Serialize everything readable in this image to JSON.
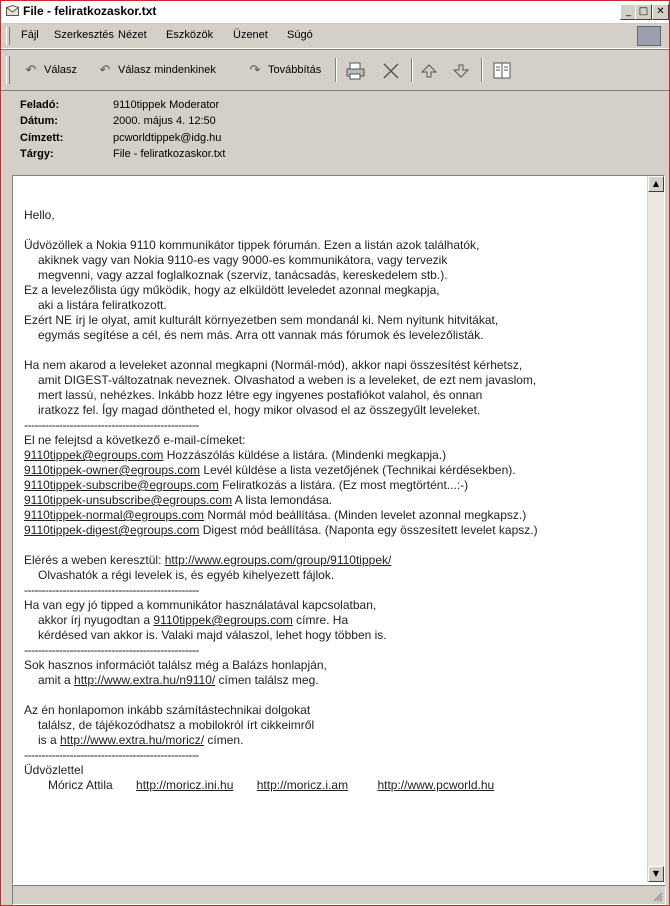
{
  "window": {
    "title": "File - feliratkozaskor.txt",
    "minimize_glyph": "_",
    "maximize_glyph": "□",
    "close_glyph": "✕"
  },
  "menu": [
    {
      "label": "Fájl"
    },
    {
      "label": "Szerkesztés"
    },
    {
      "label": "Nézet"
    },
    {
      "label": "Eszközök"
    },
    {
      "label": "Üzenet"
    },
    {
      "label": "Súgó"
    }
  ],
  "toolbar": {
    "reply": "Válasz",
    "reply_all": "Válasz mindenkinek",
    "forward": "Továbbítás"
  },
  "headers": [
    {
      "label": "Feladó:",
      "value": "9110tippek Moderator"
    },
    {
      "label": "Dátum:",
      "value": "2000. május 4. 12:50"
    },
    {
      "label": "Címzett:",
      "value": "pcworldtippek@idg.hu"
    },
    {
      "label": "Tárgy:",
      "value": "File - feliratkozaskor.txt"
    }
  ],
  "body": {
    "greeting": "Hello,",
    "intro": [
      "Üdvözöllek a Nokia 9110 kommunikátor tippek fórumán. Ezen a listán azok találhatók,",
      "akiknek vagy van Nokia 9110-es vagy 9000-es kommunikátora, vagy tervezik",
      "megvenni, vagy azzal foglalkoznak (szerviz, tanácsadás, kereskedelem stb.).",
      "Ez a levelezőlista úgy működik, hogy az elküldött leveledet azonnal megkapja,",
      "aki a listára feliratkozott.",
      "Ezért NE írj le olyat, amit kulturált környezetben sem mondanál ki. Nem nyitunk hitvitákat,",
      "egymás segítése a cél, és nem más. Arra ott vannak más fórumok és levelezőlisták."
    ],
    "digest": [
      "Ha nem akarod a leveleket azonnal megkapni (Normál-mód), akkor napi összesítést kérhetsz,",
      "amit DIGEST-változatnak neveznek. Olvashatod a weben is a leveleket, de ezt nem javaslom,",
      "mert lassú, nehézkes. Inkább hozz létre egy ingyenes postafiókot valahol, és onnan",
      "iratkozz fel. Így magad döntheted el, hogy mikor olvasod el az összegyűlt leveleket."
    ],
    "separator": "--------------------------------------------------",
    "addresses_intro": "El ne felejtsd a következő e-mail-címeket:",
    "addresses": [
      {
        "email": "9110tippek@egroups.com",
        "desc": " Hozzászólás küldése a listára. (Mindenki megkapja.)"
      },
      {
        "email": "9110tippek-owner@egroups.com",
        "desc": " Levél küldése a lista vezetőjének (Technikai kérdésekben)."
      },
      {
        "email": "9110tippek-subscribe@egroups.com",
        "desc": " Feliratkozás a listára. (Ez most megtörtént...:-)"
      },
      {
        "email": "9110tippek-unsubscribe@egroups.com",
        "desc": " A lista lemondása."
      },
      {
        "email": "9110tippek-normal@egroups.com",
        "desc": " Normál mód beállítása. (Minden levelet azonnal megkapsz.)"
      },
      {
        "email": "9110tippek-digest@egroups.com",
        "desc": " Digest mód beállítása. (Naponta egy összesített levelet kapsz.)"
      }
    ],
    "web_prefix": "Elérés a weben keresztül: ",
    "web_url": "http://www.egroups.com/group/9110tippek/",
    "web_note": "Olvashatók a régi levelek is, és egyéb kihelyezett fájlok.",
    "tip_1": "Ha van egy jó tipped a kommunikátor használatával kapcsolatban,",
    "tip_2_prefix": "akkor írj nyugodtan a ",
    "tip_2_email": "9110tippek@egroups.com",
    "tip_2_suffix": " címre. Ha",
    "tip_3": "kérdésed van akkor is. Valaki majd válaszol, lehet hogy többen is.",
    "balazs_1": "Sok hasznos információt találsz még a Balázs honlapján,",
    "balazs_2_prefix": "amit a ",
    "balazs_2_url": "http://www.extra.hu/n9110/",
    "balazs_2_suffix": "  címen találsz meg.",
    "own_1": "Az én honlapomon inkább számítástechnikai dolgokat",
    "own_2": "találsz, de tájékozódhatsz a mobilokról írt cikkeimről",
    "own_3_prefix": "is a ",
    "own_3_url": "http://www.extra.hu/moricz/",
    "own_3_suffix": " címen.",
    "closing": "Üdvözlettel",
    "signature_name": "Móricz Attila",
    "signature_links": [
      "http://moricz.ini.hu",
      "http://moricz.i.am",
      "http://www.pcworld.hu"
    ]
  },
  "scrollbar": {
    "up_glyph": "▲",
    "down_glyph": "▼"
  }
}
